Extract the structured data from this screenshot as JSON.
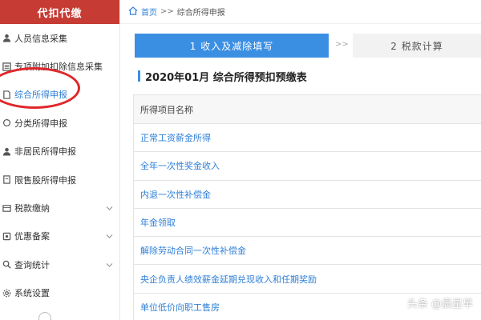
{
  "sidebar": {
    "title": "代扣代缴",
    "items": [
      {
        "label": "人员信息采集",
        "icon": "person-icon"
      },
      {
        "label": "专项附加扣除信息采集",
        "icon": "list-icon"
      },
      {
        "label": "综合所得申报",
        "icon": "document-icon",
        "active": true
      },
      {
        "label": "分类所得申报",
        "icon": "refresh-icon"
      },
      {
        "label": "非居民所得申报",
        "icon": "person-icon"
      },
      {
        "label": "限售股所得申报",
        "icon": "file-icon"
      },
      {
        "label": "税款缴纳",
        "icon": "payment-icon",
        "expandable": true
      },
      {
        "label": "优惠备案",
        "icon": "certificate-icon",
        "expandable": true
      },
      {
        "label": "查询统计",
        "icon": "search-icon",
        "expandable": true
      },
      {
        "label": "系统设置",
        "icon": "settings-icon"
      }
    ]
  },
  "breadcrumb": {
    "home": "首页",
    "separator": ">>",
    "current": "综合所得申报"
  },
  "steps": {
    "step1": "1 收入及减除填写",
    "arrow": ">>",
    "step2": "2 税款计算"
  },
  "title": "2020年01月  综合所得预扣预缴表",
  "table": {
    "header": "所得项目名称",
    "rows": [
      "正常工资薪金所得",
      "全年一次性奖金收入",
      "内退一次性补偿金",
      "年金领取",
      "解除劳动合同一次性补偿金",
      "央企负责人绩效薪金延期兑现收入和任期奖励",
      "单位低价向职工售房"
    ]
  },
  "watermark": "头条 @晨星早",
  "colors": {
    "brand_red": "#c63b33",
    "accent_blue": "#3b8fe3",
    "link_blue": "#2f7fd6",
    "highlight_red": "#e0262a"
  }
}
